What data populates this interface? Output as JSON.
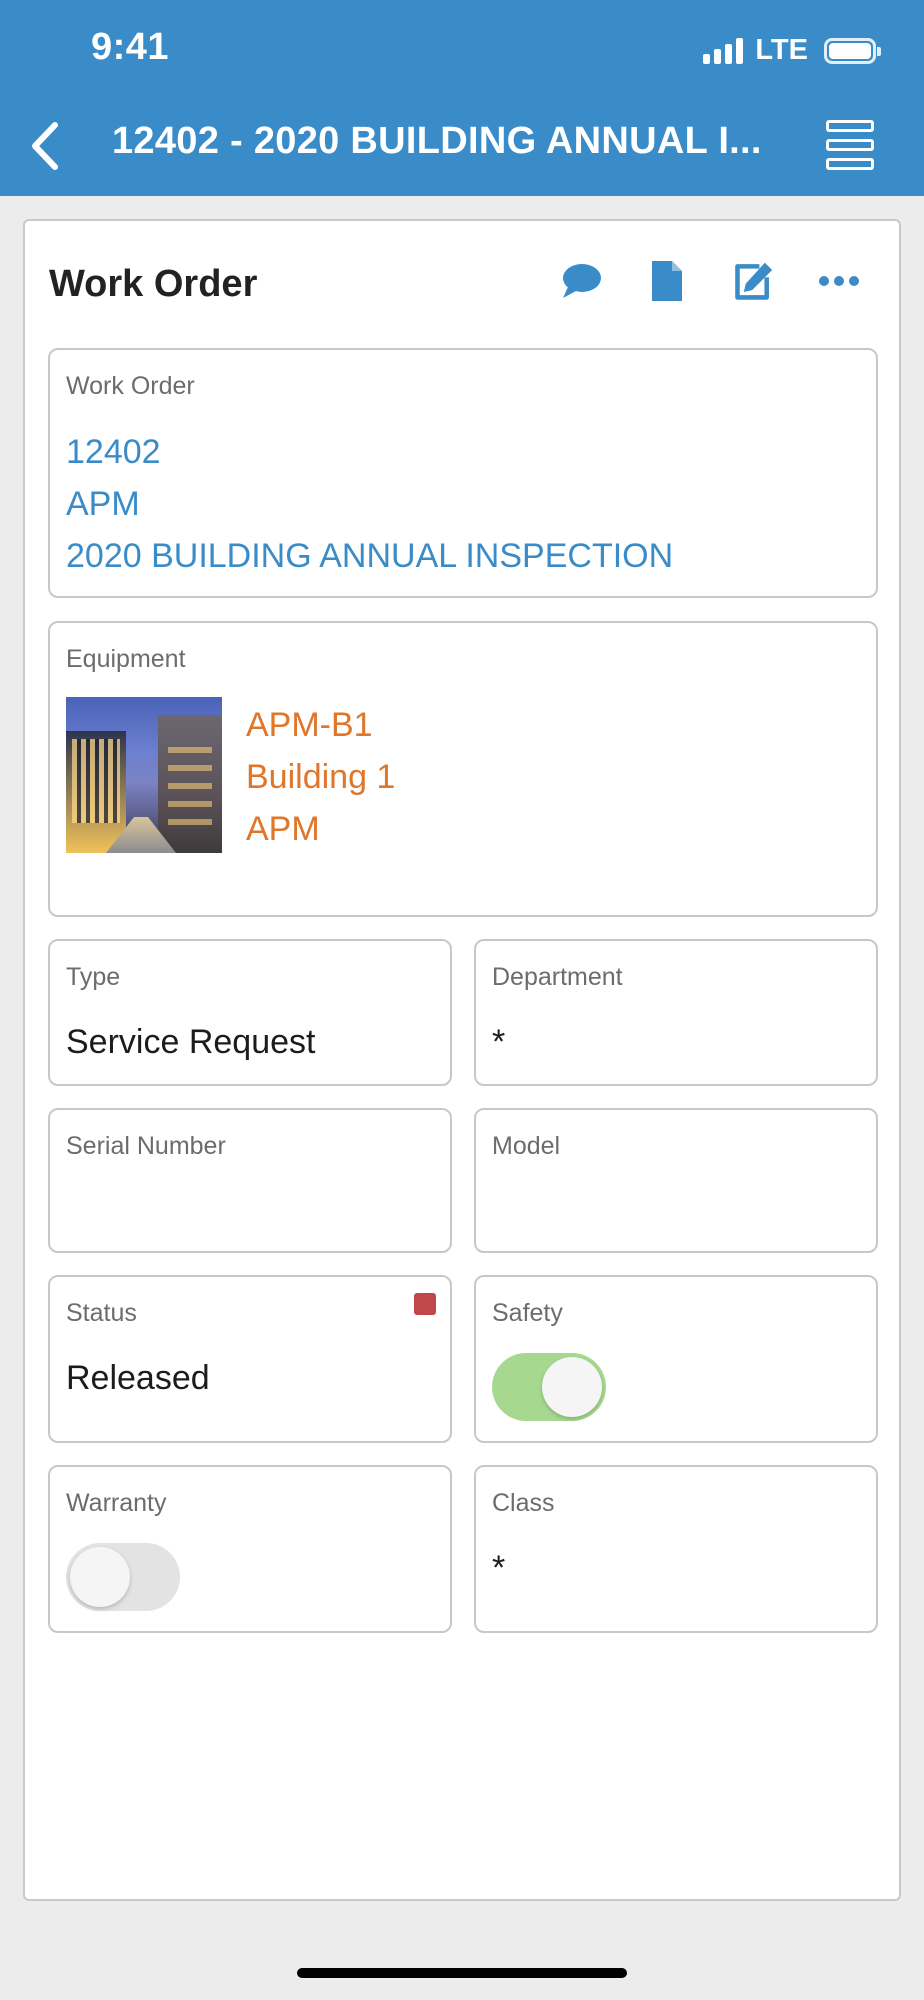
{
  "status_bar": {
    "time": "9:41",
    "network": "LTE",
    "signal_bars": 4,
    "battery_level": 1.0
  },
  "nav": {
    "title": "12402 - 2020 BUILDING ANNUAL I...",
    "back_icon": "chevron-left-icon",
    "menu_icon": "layout-rows-icon"
  },
  "card": {
    "title": "Work Order",
    "actions": [
      {
        "icon": "comment-icon"
      },
      {
        "icon": "document-icon"
      },
      {
        "icon": "edit-icon"
      },
      {
        "icon": "more-icon"
      }
    ]
  },
  "work_order": {
    "label": "Work Order",
    "number": "12402",
    "site": "APM",
    "description": "2020 BUILDING ANNUAL INSPECTION"
  },
  "equipment": {
    "label": "Equipment",
    "code": "APM-B1",
    "name": "Building 1",
    "site": "APM"
  },
  "fields": {
    "type": {
      "label": "Type",
      "value": "Service Request"
    },
    "department": {
      "label": "Department",
      "value": "*"
    },
    "serial_number": {
      "label": "Serial Number",
      "value": ""
    },
    "model": {
      "label": "Model",
      "value": ""
    },
    "status": {
      "label": "Status",
      "value": "Released",
      "flag_color": "#c0474a"
    },
    "safety": {
      "label": "Safety",
      "on": true
    },
    "warranty": {
      "label": "Warranty",
      "on": false
    },
    "class": {
      "label": "Class",
      "value": "*"
    }
  },
  "colors": {
    "brand": "#3a8cc8",
    "link_orange": "#e0762a",
    "toggle_on": "#a6d98f"
  }
}
